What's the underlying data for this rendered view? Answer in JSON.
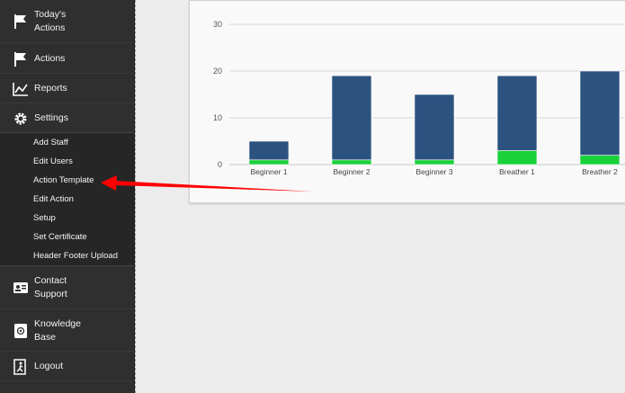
{
  "sidebar": {
    "items": [
      {
        "label": "Today's\nActions",
        "icon": "flag-icon"
      },
      {
        "label": "Actions",
        "icon": "flag-icon"
      },
      {
        "label": "Reports",
        "icon": "line-chart-icon"
      },
      {
        "label": "Settings",
        "icon": "gear-icon"
      },
      {
        "label": "Contact\nSupport",
        "icon": "contact-card-icon"
      },
      {
        "label": "Knowledge\nBase",
        "icon": "knowledge-base-icon"
      },
      {
        "label": "Logout",
        "icon": "exit-icon"
      }
    ],
    "settings_submenu": [
      "Add Staff",
      "Edit Users",
      "Action Template",
      "Edit Action",
      "Setup",
      "Set Certificate",
      "Header Footer Upload"
    ]
  },
  "chart_data": {
    "type": "bar",
    "stacked": true,
    "categories": [
      "Beginner 1",
      "Beginner 2",
      "Beginner 3",
      "Breather 1",
      "Breather 2"
    ],
    "series": [
      {
        "values": [
          1,
          1,
          1,
          3,
          2
        ],
        "color": "#1bd13a"
      },
      {
        "values": [
          4,
          18,
          14,
          16,
          18
        ],
        "color": "#2c5280"
      }
    ],
    "ylim": [
      0,
      30
    ],
    "yticks": [
      0,
      10,
      20,
      30
    ],
    "grid": true
  },
  "annotation": {
    "type": "red-arrow",
    "points_to": "Action Template",
    "color": "#ff0000"
  }
}
